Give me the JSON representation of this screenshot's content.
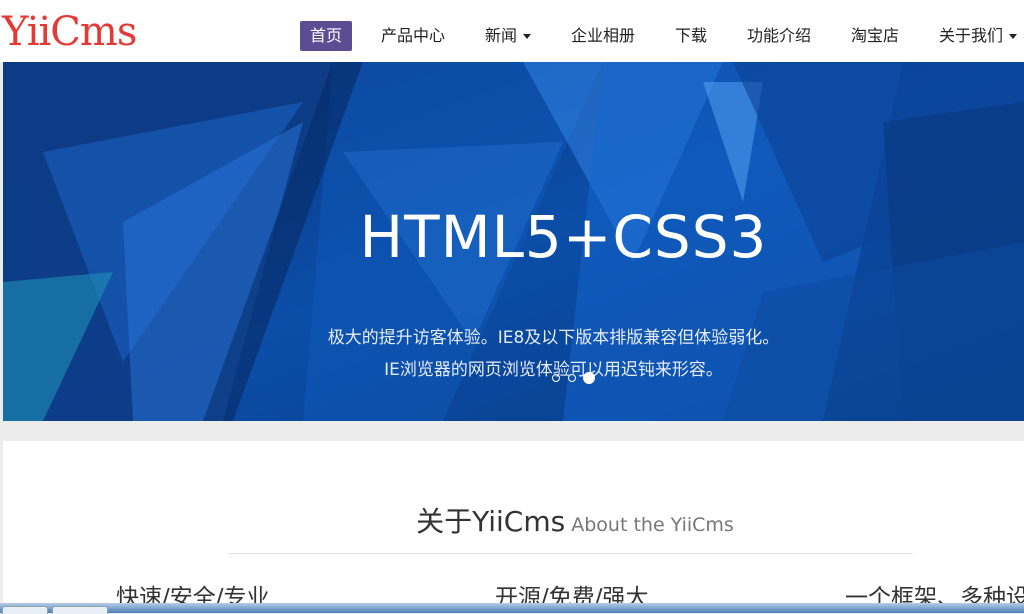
{
  "logo": "YiiCms",
  "nav": {
    "items": [
      {
        "label": "首页",
        "active": true
      },
      {
        "label": "产品中心"
      },
      {
        "label": "新闻",
        "dropdown": true
      },
      {
        "label": "企业相册"
      },
      {
        "label": "下载"
      },
      {
        "label": "功能介绍"
      },
      {
        "label": "淘宝店"
      },
      {
        "label": "关于我们",
        "dropdown": true
      }
    ]
  },
  "banner": {
    "title": "HTML5+CSS3",
    "line1": "极大的提升访客体验。IE8及以下版本排版兼容但体验弱化。",
    "line2": "IE浏览器的网页浏览体验可以用迟钝来形容。",
    "slides": 3,
    "active_slide": 3
  },
  "about": {
    "title": "关于YiiCms",
    "subtitle": "About the YiiCms",
    "features": [
      "快速/安全/专业",
      "开源/免费/强大",
      "一个框架、多种设"
    ]
  },
  "colors": {
    "accent": "#5b4c93",
    "logo": "#e53935",
    "banner": "#0b3f8a"
  }
}
